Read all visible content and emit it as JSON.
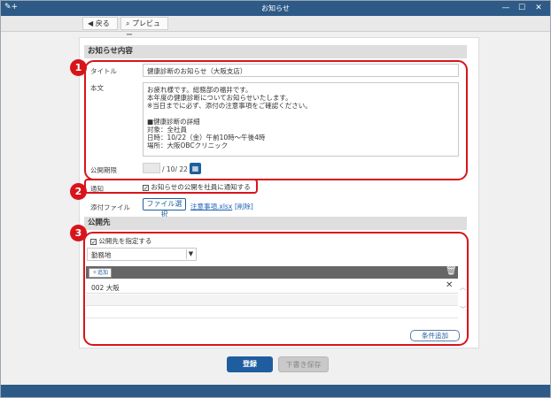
{
  "window": {
    "title": "お知らせ"
  },
  "toolbar": {
    "back_label": "◀ 戻る",
    "preview_label": "プレビュー"
  },
  "content_section": {
    "heading": "お知らせ内容",
    "title_label": "タイトル",
    "title_value": "健康診断のお知らせ（大阪支店）",
    "body_label": "本文",
    "body_lines": [
      "お疲れ様です。総務部の福井です。",
      "本年度の健康診断についてお知らせいたします。",
      "※当日までに必ず、添付の注意事項をご確認ください。",
      "",
      "■健康診断の詳細",
      "対象：全社員",
      "日時：10/22（金）午前10時～午後4時",
      "場所：大阪OBCクリニック"
    ],
    "period_label": "公開期限",
    "period_value": "/ 10/ 22",
    "notify_label": "通知",
    "notify_checkbox_label": "お知らせの公開を社員に通知する",
    "attach_label": "添付ファイル",
    "file_select_label": "ファイル選択",
    "attached_file": "注意事項.xlsx",
    "delete_label": "[削除]"
  },
  "publish_section": {
    "heading": "公開先",
    "specify_label": "公開先を指定する",
    "dropdown_value": "勤務地",
    "add_label": "追加",
    "rows": [
      {
        "value": "002 大阪"
      }
    ],
    "condition_add_label": "条件追加"
  },
  "footer": {
    "register_label": "登録",
    "draft_label": "下書き保存"
  },
  "badges": [
    "1",
    "2",
    "3"
  ],
  "colors": {
    "titlebar": "#2d5a86",
    "highlight": "#d8141b",
    "primary": "#1f5e9e"
  }
}
